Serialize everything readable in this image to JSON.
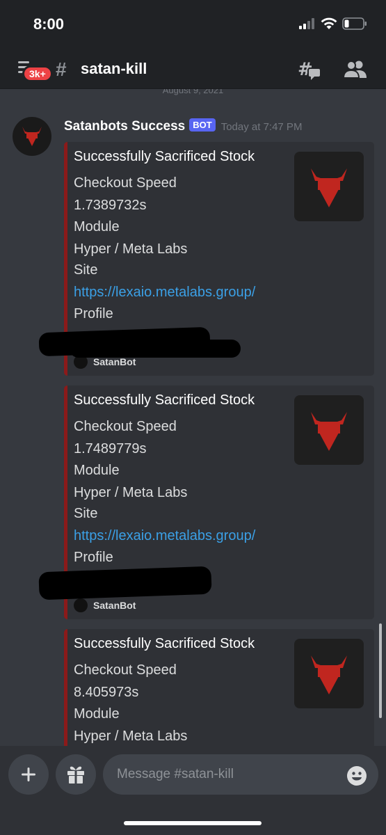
{
  "status_bar": {
    "time": "8:00"
  },
  "header": {
    "badge": "3k+",
    "hash": "#",
    "channel": "satan-kill"
  },
  "feed": {
    "date_separator": "August 9, 2021",
    "message": {
      "author": "Satanbots Success",
      "bot_tag": "BOT",
      "timestamp": "Today at 7:47 PM",
      "embeds": [
        {
          "title": "Successfully Sacrificed Stock",
          "speed_label": "Checkout Speed",
          "speed_value": "1.7389732s",
          "module_label": "Module",
          "module_value": "Hyper / Meta Labs",
          "site_label": "Site",
          "site_value": "https://lexaio.metalabs.group/",
          "profile_label": "Profile",
          "footer": "SatanBot"
        },
        {
          "title": "Successfully Sacrificed Stock",
          "speed_label": "Checkout Speed",
          "speed_value": "1.7489779s",
          "module_label": "Module",
          "module_value": "Hyper / Meta Labs",
          "site_label": "Site",
          "site_value": "https://lexaio.metalabs.group/",
          "profile_label": "Profile",
          "footer": "SatanBot"
        },
        {
          "title": "Successfully Sacrificed Stock",
          "speed_label": "Checkout Speed",
          "speed_value": "8.405973s",
          "module_label": "Module",
          "module_value": "Hyper / Meta Labs"
        }
      ]
    }
  },
  "composer": {
    "placeholder": "Message #satan-kill"
  },
  "colors": {
    "background": "#36393f",
    "header": "#202225",
    "embed_bg": "#2f3136",
    "embed_accent": "#8b1a1a",
    "link": "#3ba0e6",
    "bot_tag": "#5865f2",
    "badge": "#ed4245",
    "logo_red": "#c0261f"
  },
  "icons": [
    "hamburger-menu-icon",
    "hash-icon",
    "threads-icon",
    "members-icon",
    "satan-logo-icon",
    "plus-icon",
    "gift-icon",
    "emoji-icon",
    "signal-icon",
    "wifi-icon",
    "battery-icon"
  ]
}
